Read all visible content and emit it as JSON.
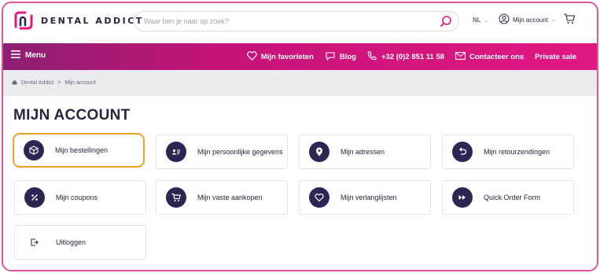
{
  "brand": {
    "name": "DENTAL ADDICT",
    "accent": "#e21784",
    "dark": "#2f2552",
    "highlight": "#f0a02a"
  },
  "search": {
    "placeholder": "Waar ben je naar op zoek?"
  },
  "header": {
    "language": "NL",
    "account_label": "Mijn account"
  },
  "nav": {
    "menu_label": "Menu",
    "links": [
      {
        "label": "Mijn favorieten",
        "icon": "heart-icon"
      },
      {
        "label": "Blog",
        "icon": "chat-icon"
      },
      {
        "label": "+32 (0)2 851 11 58",
        "icon": "phone-icon"
      },
      {
        "label": "Contacteer ons",
        "icon": "mail-icon"
      },
      {
        "label": "Private sale",
        "icon": ""
      }
    ]
  },
  "breadcrumb": {
    "home": "Dental Addict",
    "separator": ">",
    "current": "Mijn account"
  },
  "page": {
    "title": "MIJN ACCOUNT"
  },
  "tiles": [
    {
      "label": "Mijn bestellingen",
      "icon": "box-icon",
      "active": true
    },
    {
      "label": "Mijn persoonlijke gegevens",
      "icon": "id-card-icon",
      "active": false
    },
    {
      "label": "Mijn adressen",
      "icon": "location-pin-icon",
      "active": false
    },
    {
      "label": "Mijn retourzendingen",
      "icon": "return-arrow-icon",
      "active": false
    },
    {
      "label": "Mijn coupons",
      "icon": "percent-icon",
      "active": false
    },
    {
      "label": "Mijn vaste aankopen",
      "icon": "cart-icon",
      "active": false
    },
    {
      "label": "Mijn verlanglijsten",
      "icon": "heart-icon",
      "active": false
    },
    {
      "label": "Quick Order Form",
      "icon": "fast-forward-icon",
      "active": false
    },
    {
      "label": "Uitloggen",
      "icon": "logout-icon",
      "active": false
    }
  ]
}
